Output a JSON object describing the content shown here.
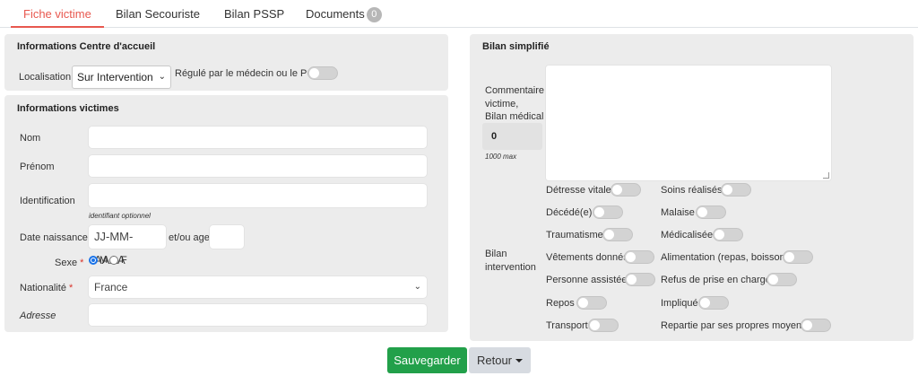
{
  "tabs": {
    "fiche_victime": "Fiche victime",
    "bilan_secouriste": "Bilan Secouriste",
    "bilan_pssp": "Bilan PSSP",
    "documents": "Documents",
    "documents_count": "0"
  },
  "centre": {
    "title": "Informations Centre d'accueil",
    "localisation_label": "Localisation",
    "localisation_value": "Sur Intervention",
    "regule_label": "Régulé par le médecin ou le PC"
  },
  "victime": {
    "title": "Informations victimes",
    "nom_label": "Nom",
    "prenom_label": "Prénom",
    "identification_label": "Identification",
    "identification_hint": "identifiant optionnel",
    "date_label": "Date naissance",
    "date_placeholder": "JJ-MM-AAAA",
    "age_label": "et/ou age",
    "sexe_label": "Sexe",
    "sexe_m": "M",
    "sexe_f": "F",
    "nationalite_label": "Nationalité",
    "nationalite_value": "France",
    "adresse_label": "Adresse",
    "required_mark": "*"
  },
  "bilan": {
    "title": "Bilan simplifié",
    "commentaire_line1": "Commentaire",
    "commentaire_line2": "victime,",
    "commentaire_line3": "Bilan médical",
    "counter": "0",
    "max_hint": "1000 max",
    "intervention_line1": "Bilan",
    "intervention_line2": "intervention",
    "toggles_left": [
      "Détresse vitale",
      "Décédé(e)",
      "Traumatisme",
      "Vêtements donnés",
      "Personne assistée",
      "Repos",
      "Transport"
    ],
    "toggles_right": [
      "Soins réalisés",
      "Malaise",
      "Médicalisée",
      "Alimentation (repas, boisson)",
      "Refus de prise en charge",
      "Impliqué",
      "Repartie par ses propres moyens"
    ]
  },
  "actions": {
    "save": "Sauvegarder",
    "back": "Retour"
  },
  "colors": {
    "active_tab": "#e8584f",
    "save_button": "#22a04a",
    "panel_bg": "#ececec",
    "radio_checked": "#1a73e8",
    "required": "#d9342b"
  }
}
